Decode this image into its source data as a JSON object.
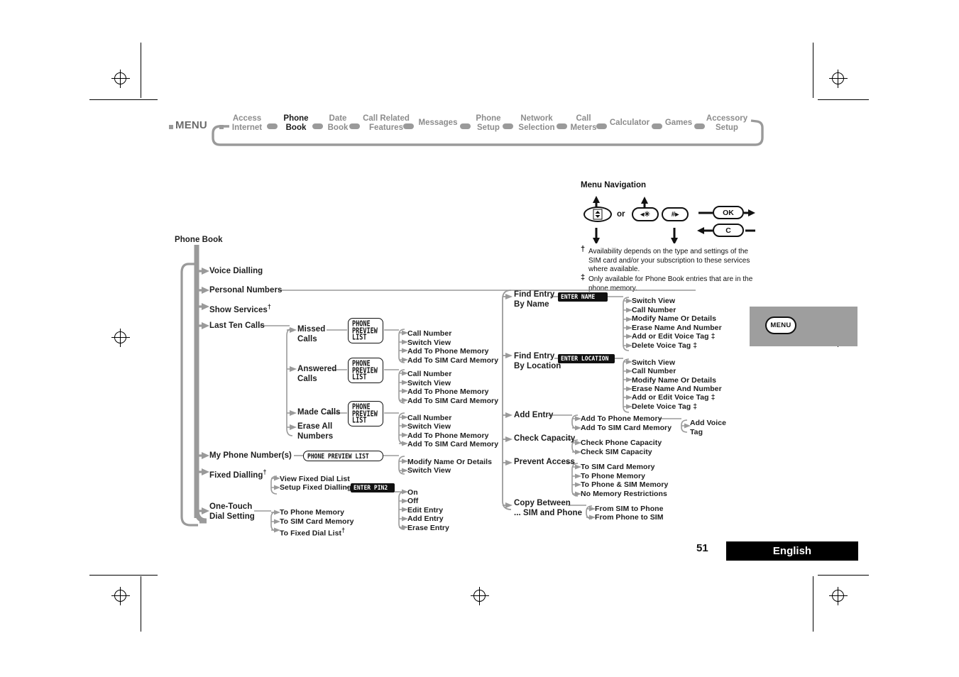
{
  "page": {
    "number": "51",
    "language": "English",
    "accent_grey": "#9a9a9a",
    "text_color": "#1d1d1d"
  },
  "menubar": {
    "menu_label": "MENU",
    "items": [
      {
        "label": "Access\nInternet",
        "current": false
      },
      {
        "label": "Phone\nBook",
        "current": true
      },
      {
        "label": "Date\nBook",
        "current": false
      },
      {
        "label": "Call Related\nFeatures",
        "current": false
      },
      {
        "label": "Messages",
        "current": false
      },
      {
        "label": "Phone\nSetup",
        "current": false
      },
      {
        "label": "Network\nSelection",
        "current": false
      },
      {
        "label": "Call\nMeters",
        "current": false
      },
      {
        "label": "Calculator",
        "current": false
      },
      {
        "label": "Games",
        "current": false
      },
      {
        "label": "Accessory\nSetup",
        "current": false
      }
    ]
  },
  "navigation": {
    "title": "Menu Navigation",
    "or_label": "or",
    "keys": {
      "rocker": "up-down-rocker",
      "star": "◂✳",
      "hash": "#▸",
      "ok": "OK",
      "clear": "C"
    },
    "footnotes": [
      {
        "mark": "†",
        "text": "Availability depends on the type and settings of the SIM card and/or your subscription to these services where available."
      },
      {
        "mark": "‡",
        "text": "Only available for Phone Book entries that are in the phone memory."
      }
    ]
  },
  "menu_chip": {
    "label": "MENU"
  },
  "tree": {
    "root": "Phone Book",
    "level1": [
      {
        "label": "Voice Dialling"
      },
      {
        "label": "Personal Numbers"
      },
      {
        "label": "Show Services",
        "dagger": "†"
      },
      {
        "label": "Last Ten Calls"
      },
      {
        "label": "My Phone Number(s)"
      },
      {
        "label": "Fixed Dialling",
        "dagger": "†"
      },
      {
        "label": "One-Touch\nDial Setting"
      }
    ],
    "last_ten_calls": [
      {
        "label": "Missed\nCalls"
      },
      {
        "label": "Answered\nCalls"
      },
      {
        "label": "Made Calls"
      },
      {
        "label": "Erase All\nNumbers"
      }
    ],
    "call_list_actions": [
      "Call Number",
      "Switch View",
      "Add To Phone Memory",
      "Add To SIM Card Memory"
    ],
    "my_phone_number_actions": [
      "Modify Name Or Details",
      "Switch View"
    ],
    "fixed_dialling": [
      "View Fixed Dial List",
      "Setup Fixed Dialling"
    ],
    "fixed_dialling_pin_actions": [
      "On",
      "Off",
      "Edit Entry",
      "Add Entry",
      "Erase Entry"
    ],
    "one_touch": [
      {
        "label": "To Phone Memory"
      },
      {
        "label": "To SIM Card Memory"
      },
      {
        "label": "To Fixed Dial List",
        "dagger": "†"
      }
    ],
    "personal_numbers_branch": [
      {
        "label": "Find Entry\nBy Name"
      },
      {
        "label": "Find Entry\nBy Location"
      },
      {
        "label": "Add Entry"
      },
      {
        "label": "Check Capacity"
      },
      {
        "label": "Prevent Access"
      },
      {
        "label": "Copy Between\n... SIM and Phone"
      }
    ],
    "entry_actions": [
      {
        "label": "Switch View",
        "mark": ""
      },
      {
        "label": "Call Number",
        "mark": ""
      },
      {
        "label": "Modify Name Or Details",
        "mark": ""
      },
      {
        "label": "Erase Name And Number",
        "mark": ""
      },
      {
        "label": "Add or Edit Voice Tag",
        "mark": "‡"
      },
      {
        "label": "Delete Voice Tag",
        "mark": "‡"
      }
    ],
    "add_entry_actions": [
      "Add To Phone Memory",
      "Add To SIM Card Memory"
    ],
    "add_voice_tag": "Add Voice\nTag",
    "check_capacity_actions": [
      "Check Phone Capacity",
      "Check SIM Capacity"
    ],
    "prevent_access_actions": [
      "To SIM Card Memory",
      "To Phone Memory",
      "To Phone & SIM Memory",
      "No Memory Restrictions"
    ],
    "copy_between_actions": [
      "From SIM to Phone",
      "From Phone to SIM"
    ]
  },
  "lcd_screens": {
    "phone_preview_list_lines": [
      "PHONE",
      "PREVIEW",
      "LIST"
    ],
    "phone_preview_list_inline": "PHONE PREVIEW LIST",
    "enter_name": "ENTER NAME",
    "enter_location": "ENTER LOCATION",
    "enter_pin2": "ENTER PIN2"
  }
}
